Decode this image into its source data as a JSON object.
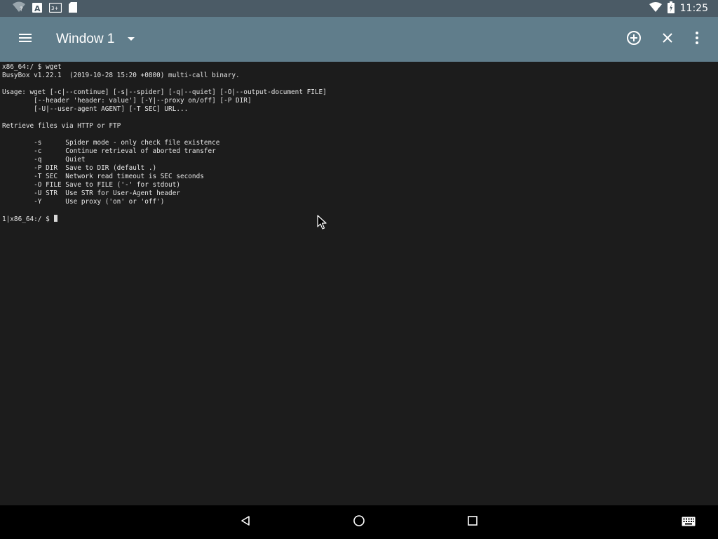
{
  "status_bar": {
    "time": "11:25",
    "left_icons": [
      "wifi-question-icon",
      "font-a-icon",
      "keyboard-layout-icon",
      "sd-card-icon"
    ],
    "right_icons": [
      "wifi-icon",
      "battery-icon"
    ]
  },
  "toolbar": {
    "window_title": "Window 1",
    "icons": [
      "menu-icon",
      "dropdown-arrow-icon",
      "add-circle-icon",
      "close-icon",
      "more-vert-icon"
    ]
  },
  "terminal": {
    "lines": [
      "x86_64:/ $ wget",
      "BusyBox v1.22.1  (2019-10-28 15:20 +0800) multi-call binary.",
      "",
      "Usage: wget [-c|--continue] [-s|--spider] [-q|--quiet] [-O|--output-document FILE]",
      "        [--header 'header: value'] [-Y|--proxy on/off] [-P DIR]",
      "        [-U|--user-agent AGENT] [-T SEC] URL...",
      "",
      "Retrieve files via HTTP or FTP",
      "",
      "        -s      Spider mode - only check file existence",
      "        -c      Continue retrieval of aborted transfer",
      "        -q      Quiet",
      "        -P DIR  Save to DIR (default .)",
      "        -T SEC  Network read timeout is SEC seconds",
      "        -O FILE Save to FILE ('-' for stdout)",
      "        -U STR  Use STR for User-Agent header",
      "        -Y      Use proxy ('on' or 'off')",
      ""
    ],
    "prompt": "1|x86_64:/ $ "
  },
  "nav_bar": {
    "icons": [
      "back-triangle-icon",
      "home-circle-icon",
      "recents-square-icon",
      "keyboard-icon"
    ]
  },
  "colors": {
    "status_bar": "#4b5b66",
    "toolbar": "#607d8b",
    "terminal_bg": "#1c1c1c",
    "terminal_fg": "#e6e6e6",
    "nav_bar": "#000000"
  }
}
